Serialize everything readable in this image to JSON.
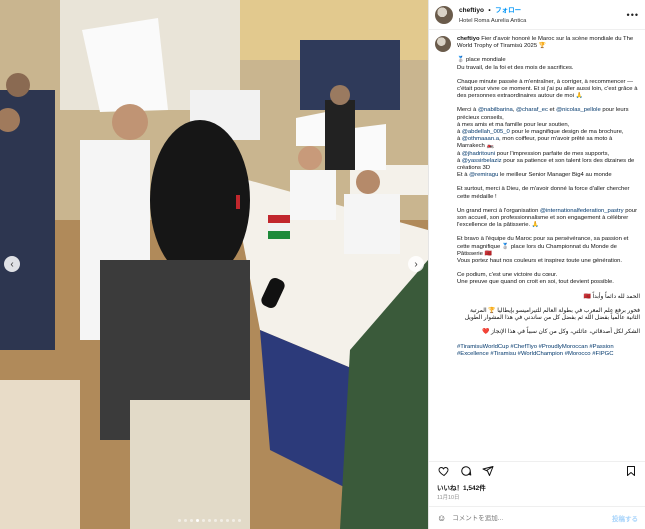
{
  "header": {
    "username": "cheftiyo",
    "follow_sep": "•",
    "follow_label": "フォロー",
    "location": "Hotel Roma Aurelia Antica",
    "more_icon": "more-horizontal-icon"
  },
  "caption": {
    "username": "cheftiyo",
    "intro": "Fier d'avoir honoré le Maroc sur la scène mondiale du The World Trophy of Tiramisù 2025 🏆",
    "p1_l1": "🥈 place mondiale",
    "p1_l2": "Du travail, de la foi et des mois de sacrifices.",
    "p2": "Chaque minute passée à m'entraîner, à corriger, à recommencer — c'était pour vivre ce moment. Et si j'ai pu aller aussi loin, c'est grâce à des personnes extraordinaires autour de moi 🙏",
    "thanks_intro": "Merci à",
    "m1": "@nabilbarina",
    "m2": "@charaf_ec",
    "m3": "@nicolas_pellole",
    "t_a": "et",
    "t_b": "pour leurs précieux conseils,",
    "t_family": "à mes amis et ma famille pour leur soutien,",
    "t_a_a": "à",
    "m4": "@abdellah_005_0",
    "t_brochure": "pour le magnifique design de ma brochure,",
    "m5": "@othmaaan.a",
    "t_moto": ", mon coiffeur, pour m'avoir prêté sa moto à Marrakech 🏍️",
    "m6": "@jhadritouni",
    "t_print": "pour l'impression parfaite de mes supports,",
    "m7": "@yassirbelaziz",
    "t_3d": "pour sa patience et son talent lors des dizaines de créations 3D",
    "t_et_a": "Et à",
    "m8": "@remiragu",
    "t_manager": "le meilleur Senior Manager Big4 au monde",
    "p_faith": "Et surtout, merci à Dieu, de m'avoir donné la force d'aller chercher cette médaille !",
    "org_intro": "Un grand merci à l'organisation",
    "m9": "@internationalfederation_pastry",
    "org_rest": "pour son accueil, son professionnalisme et son engagement à célébrer l'excellence de la pâtisserie. 🙏",
    "team": "Et bravo à l'équipe du Maroc pour sa persévérance, sa passion et cette magnifique 🥈 place lors du Championnat du Monde de Pâtisserie 🇲🇦",
    "colors": "Vous portez haut nos couleurs et inspirez toute une génération.",
    "victory_l1": "Ce podium, c'est une victoire du cœur.",
    "victory_l2": "Une preuve que quand on croit en soi, tout devient possible.",
    "ar1": "الحمد لله دائماً وأبداً 🇲🇦",
    "ar2": "فخور برفع علم المغرب في بطولة العالم للتيراميسو بإيطاليا 🏆 المرتبة الثانية عالمياً بفضل الله ثم بفضل كل من ساندني في هذا المشوار الطويل",
    "ar3": "الشكر لكل أصدقائي، عائلتي، وكل من كان سبباً في هذا الإنجاز ❤️",
    "hashtags": "#TiramisuWorldCup #ChefTiyo #ProudlyMoroccan #Passion #Excellence #Tiramisu #WorldChampion #Morocco #FIPGC"
  },
  "actions": {
    "like_icon": "heart-icon",
    "comment_icon": "comment-icon",
    "share_icon": "send-icon",
    "save_icon": "bookmark-icon"
  },
  "likes": "いいね！1,542件",
  "date": "11月10日",
  "comment": {
    "emoji_icon": "emoji-icon",
    "placeholder": "コメントを追加...",
    "post_label": "投稿する"
  },
  "photo": {
    "alt_icon": "photo",
    "current_slide": 4,
    "total_slides": 11
  }
}
